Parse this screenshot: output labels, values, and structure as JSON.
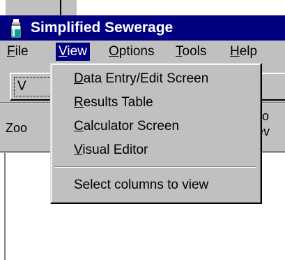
{
  "window": {
    "title": "Simplified Sewerage",
    "title_bar_color": "#000080",
    "chrome_color": "#c0c0c0",
    "app_icon": "bottle-icon"
  },
  "menubar": {
    "items": [
      {
        "label": "File"
      },
      {
        "label": "View"
      },
      {
        "label": "Options"
      },
      {
        "label": "Tools"
      },
      {
        "label": "Help"
      }
    ],
    "active": "View"
  },
  "toolbar": {
    "button1_label": "V"
  },
  "secondary_bar": {
    "left_label": "Zoo",
    "right_label_line1": "n to",
    "right_label_line2": "Sev"
  },
  "view_menu": {
    "items": [
      {
        "label": "Data Entry/Edit Screen"
      },
      {
        "label": "Results Table"
      },
      {
        "label": "Calculator Screen"
      },
      {
        "label": "Visual Editor"
      }
    ],
    "extra_item": {
      "label": "Select columns to view"
    }
  }
}
